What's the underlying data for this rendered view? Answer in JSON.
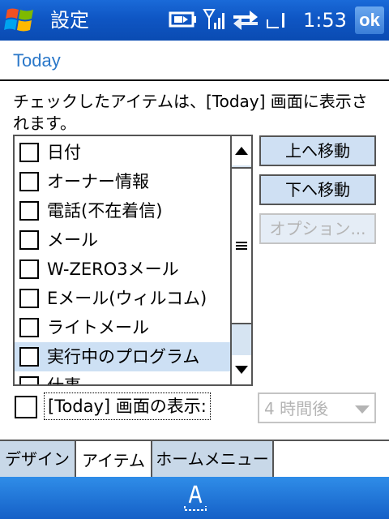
{
  "titlebar": {
    "title": "設定",
    "clock": "1:53",
    "ok_label": "ok",
    "icons": [
      "windows-start-icon",
      "battery-icon",
      "signal-icon",
      "sync-arrows-icon",
      "connection-icon"
    ]
  },
  "page": {
    "heading": "Today",
    "description": "チェックしたアイテムは、[Today] 画面に表示されます。"
  },
  "list": {
    "items": [
      {
        "label": "日付",
        "checked": false,
        "selected": false
      },
      {
        "label": "オーナー情報",
        "checked": false,
        "selected": false
      },
      {
        "label": "電話(不在着信)",
        "checked": false,
        "selected": false
      },
      {
        "label": "メール",
        "checked": false,
        "selected": false
      },
      {
        "label": "W-ZERO3メール",
        "checked": false,
        "selected": false
      },
      {
        "label": "Eメール(ウィルコム)",
        "checked": false,
        "selected": false
      },
      {
        "label": "ライトメール",
        "checked": false,
        "selected": false
      },
      {
        "label": "実行中のプログラム",
        "checked": false,
        "selected": true
      },
      {
        "label": "仕事",
        "checked": false,
        "selected": false
      }
    ]
  },
  "buttons": {
    "move_up": "上へ移動",
    "move_down": "下へ移動",
    "options": "オプション..."
  },
  "display_option": {
    "label": "[Today] 画面の表示:",
    "checked": false,
    "combo_value": "4 時間後"
  },
  "tabs": [
    {
      "label": "デザイン",
      "active": false
    },
    {
      "label": "アイテム",
      "active": true
    },
    {
      "label": "ホームメニュー",
      "active": false
    }
  ],
  "softbar": {
    "icon": "keyboard-icon"
  },
  "colors": {
    "title_bar": "#0f56c4",
    "heading": "#2b78c9",
    "selection": "#cde0f4",
    "button": "#cfe0f3",
    "soft_bar": "#1f74d8"
  }
}
